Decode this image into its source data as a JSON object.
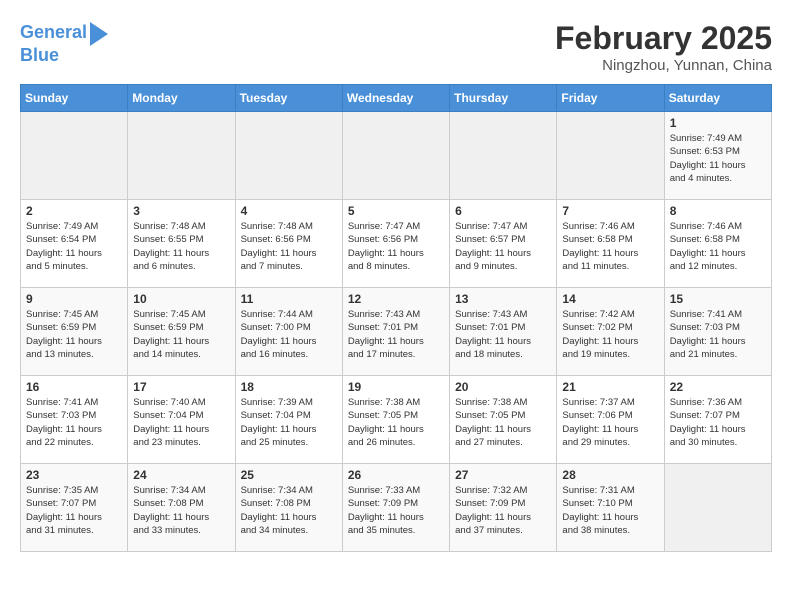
{
  "header": {
    "logo_line1": "General",
    "logo_line2": "Blue",
    "month_title": "February 2025",
    "location": "Ningzhou, Yunnan, China"
  },
  "weekdays": [
    "Sunday",
    "Monday",
    "Tuesday",
    "Wednesday",
    "Thursday",
    "Friday",
    "Saturday"
  ],
  "weeks": [
    [
      {
        "day": "",
        "info": ""
      },
      {
        "day": "",
        "info": ""
      },
      {
        "day": "",
        "info": ""
      },
      {
        "day": "",
        "info": ""
      },
      {
        "day": "",
        "info": ""
      },
      {
        "day": "",
        "info": ""
      },
      {
        "day": "1",
        "info": "Sunrise: 7:49 AM\nSunset: 6:53 PM\nDaylight: 11 hours\nand 4 minutes."
      }
    ],
    [
      {
        "day": "2",
        "info": "Sunrise: 7:49 AM\nSunset: 6:54 PM\nDaylight: 11 hours\nand 5 minutes."
      },
      {
        "day": "3",
        "info": "Sunrise: 7:48 AM\nSunset: 6:55 PM\nDaylight: 11 hours\nand 6 minutes."
      },
      {
        "day": "4",
        "info": "Sunrise: 7:48 AM\nSunset: 6:56 PM\nDaylight: 11 hours\nand 7 minutes."
      },
      {
        "day": "5",
        "info": "Sunrise: 7:47 AM\nSunset: 6:56 PM\nDaylight: 11 hours\nand 8 minutes."
      },
      {
        "day": "6",
        "info": "Sunrise: 7:47 AM\nSunset: 6:57 PM\nDaylight: 11 hours\nand 9 minutes."
      },
      {
        "day": "7",
        "info": "Sunrise: 7:46 AM\nSunset: 6:58 PM\nDaylight: 11 hours\nand 11 minutes."
      },
      {
        "day": "8",
        "info": "Sunrise: 7:46 AM\nSunset: 6:58 PM\nDaylight: 11 hours\nand 12 minutes."
      }
    ],
    [
      {
        "day": "9",
        "info": "Sunrise: 7:45 AM\nSunset: 6:59 PM\nDaylight: 11 hours\nand 13 minutes."
      },
      {
        "day": "10",
        "info": "Sunrise: 7:45 AM\nSunset: 6:59 PM\nDaylight: 11 hours\nand 14 minutes."
      },
      {
        "day": "11",
        "info": "Sunrise: 7:44 AM\nSunset: 7:00 PM\nDaylight: 11 hours\nand 16 minutes."
      },
      {
        "day": "12",
        "info": "Sunrise: 7:43 AM\nSunset: 7:01 PM\nDaylight: 11 hours\nand 17 minutes."
      },
      {
        "day": "13",
        "info": "Sunrise: 7:43 AM\nSunset: 7:01 PM\nDaylight: 11 hours\nand 18 minutes."
      },
      {
        "day": "14",
        "info": "Sunrise: 7:42 AM\nSunset: 7:02 PM\nDaylight: 11 hours\nand 19 minutes."
      },
      {
        "day": "15",
        "info": "Sunrise: 7:41 AM\nSunset: 7:03 PM\nDaylight: 11 hours\nand 21 minutes."
      }
    ],
    [
      {
        "day": "16",
        "info": "Sunrise: 7:41 AM\nSunset: 7:03 PM\nDaylight: 11 hours\nand 22 minutes."
      },
      {
        "day": "17",
        "info": "Sunrise: 7:40 AM\nSunset: 7:04 PM\nDaylight: 11 hours\nand 23 minutes."
      },
      {
        "day": "18",
        "info": "Sunrise: 7:39 AM\nSunset: 7:04 PM\nDaylight: 11 hours\nand 25 minutes."
      },
      {
        "day": "19",
        "info": "Sunrise: 7:38 AM\nSunset: 7:05 PM\nDaylight: 11 hours\nand 26 minutes."
      },
      {
        "day": "20",
        "info": "Sunrise: 7:38 AM\nSunset: 7:05 PM\nDaylight: 11 hours\nand 27 minutes."
      },
      {
        "day": "21",
        "info": "Sunrise: 7:37 AM\nSunset: 7:06 PM\nDaylight: 11 hours\nand 29 minutes."
      },
      {
        "day": "22",
        "info": "Sunrise: 7:36 AM\nSunset: 7:07 PM\nDaylight: 11 hours\nand 30 minutes."
      }
    ],
    [
      {
        "day": "23",
        "info": "Sunrise: 7:35 AM\nSunset: 7:07 PM\nDaylight: 11 hours\nand 31 minutes."
      },
      {
        "day": "24",
        "info": "Sunrise: 7:34 AM\nSunset: 7:08 PM\nDaylight: 11 hours\nand 33 minutes."
      },
      {
        "day": "25",
        "info": "Sunrise: 7:34 AM\nSunset: 7:08 PM\nDaylight: 11 hours\nand 34 minutes."
      },
      {
        "day": "26",
        "info": "Sunrise: 7:33 AM\nSunset: 7:09 PM\nDaylight: 11 hours\nand 35 minutes."
      },
      {
        "day": "27",
        "info": "Sunrise: 7:32 AM\nSunset: 7:09 PM\nDaylight: 11 hours\nand 37 minutes."
      },
      {
        "day": "28",
        "info": "Sunrise: 7:31 AM\nSunset: 7:10 PM\nDaylight: 11 hours\nand 38 minutes."
      },
      {
        "day": "",
        "info": ""
      }
    ]
  ]
}
